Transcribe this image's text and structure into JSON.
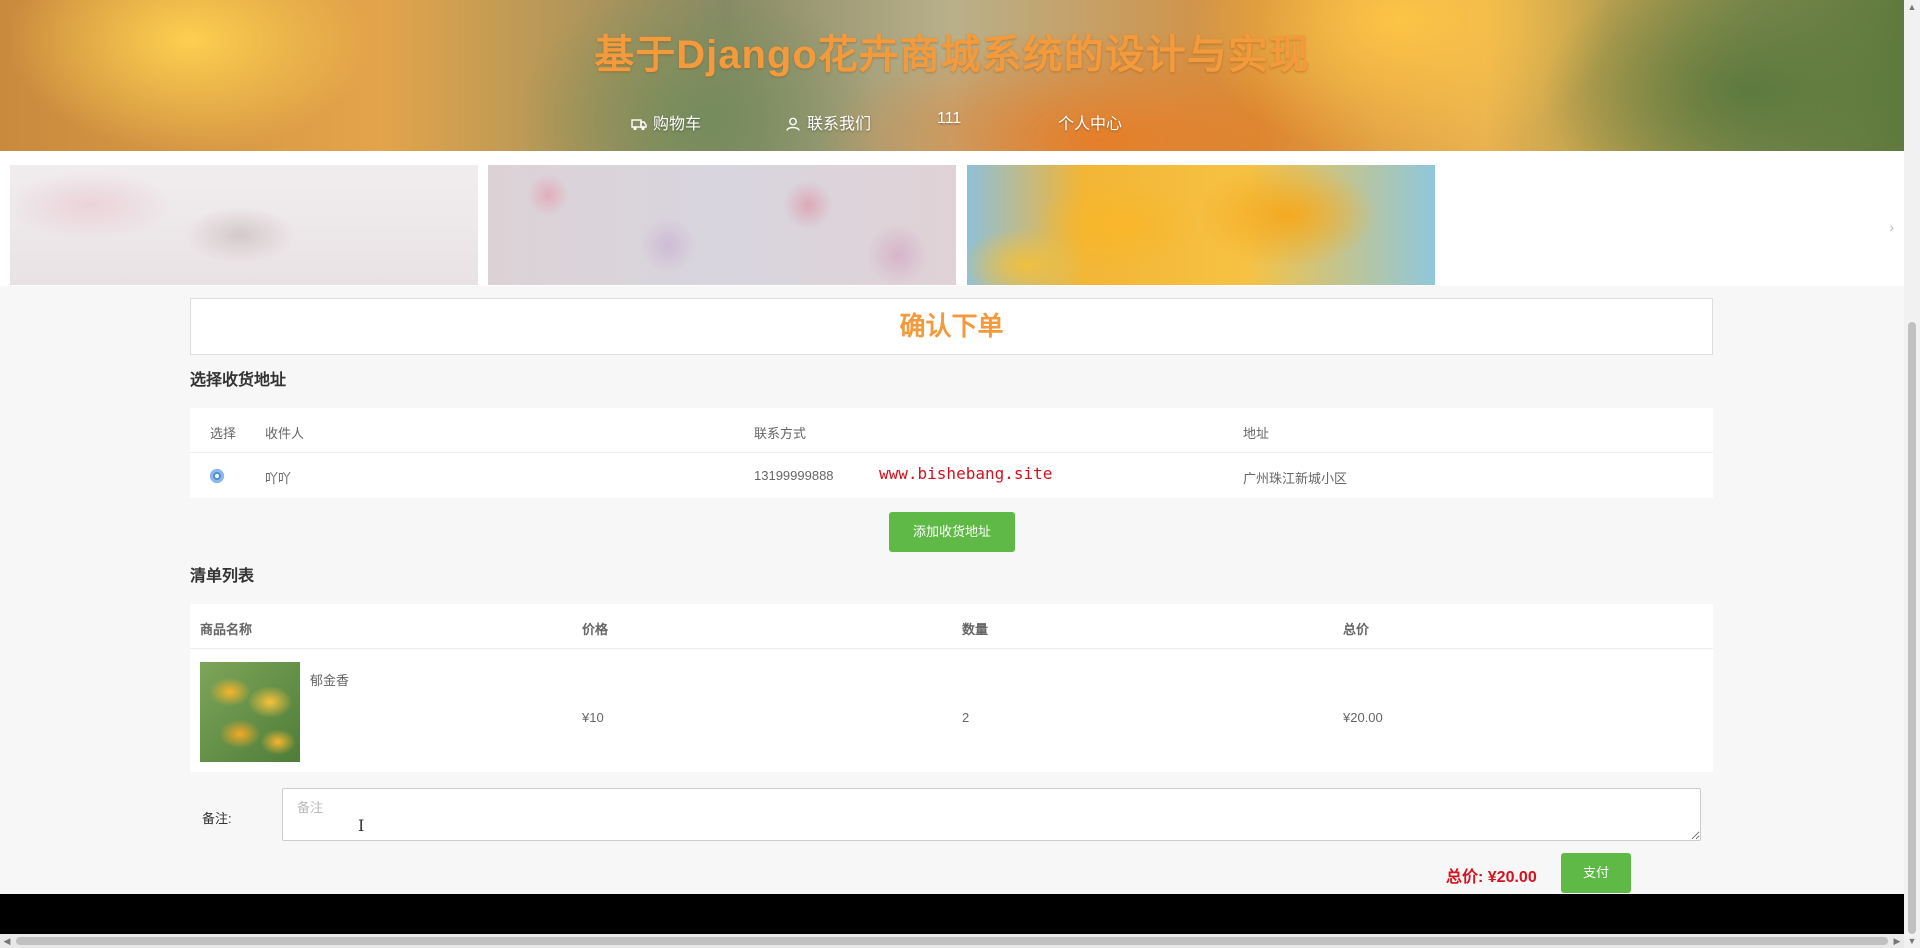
{
  "header": {
    "title": "基于Django花卉商城系统的设计与实现",
    "nav": [
      {
        "label": "购物车",
        "icon": "truck-icon"
      },
      {
        "label": "联系我们",
        "icon": "user-icon"
      },
      {
        "label": "111"
      },
      {
        "label": "个人中心"
      }
    ]
  },
  "banner": {
    "slides": [
      "castle-cherry-blossom-image",
      "flower-field-image",
      "yellow-lily-image"
    ],
    "next_icon": "chevron-right-icon"
  },
  "page": {
    "confirm_title": "确认下单",
    "address_section_title": "选择收货地址",
    "address_columns": [
      "选择",
      "收件人",
      "联系方式",
      "地址"
    ],
    "addresses": [
      {
        "selected": true,
        "recipient": "吖吖",
        "phone": "13199999888",
        "address": "广州珠江新城小区"
      }
    ],
    "watermark": "www.bishebang.site",
    "add_address_button": "添加收货地址",
    "list_section_title": "清单列表",
    "goods_columns": [
      "商品名称",
      "价格",
      "数量",
      "总价"
    ],
    "goods": [
      {
        "name": "郁金香",
        "image": "lily-product-image",
        "price": "¥10",
        "quantity": "2",
        "total": "¥20.00"
      }
    ],
    "remark_label": "备注:",
    "remark_placeholder": "备注",
    "total_label": "总价: ¥20.00",
    "pay_button": "支付"
  },
  "colors": {
    "accent_orange": "#f39a3c",
    "button_green": "#5fb946",
    "price_red": "#d4111e"
  }
}
